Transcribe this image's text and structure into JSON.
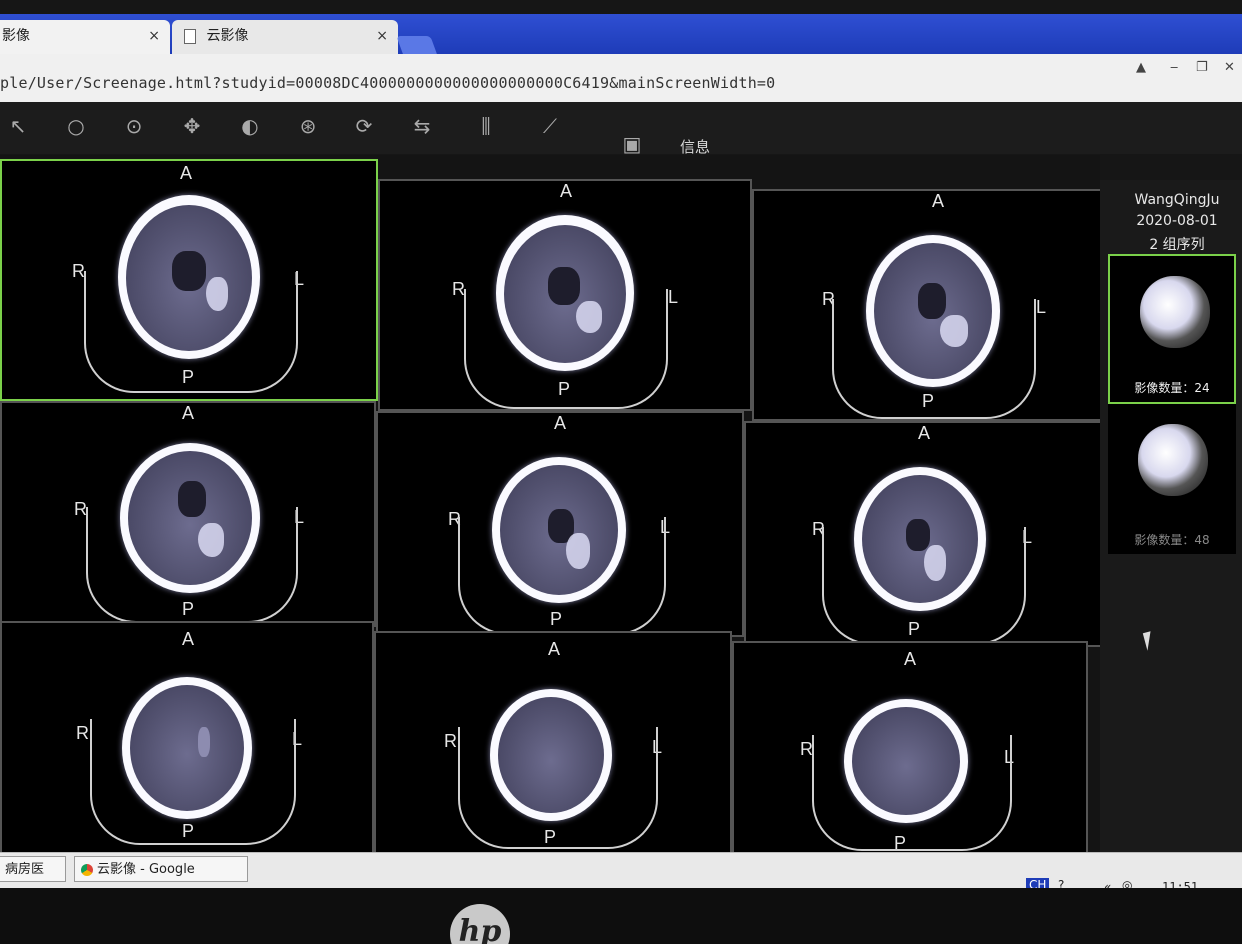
{
  "browser": {
    "tabs": [
      {
        "label": "影像",
        "close": "×"
      },
      {
        "label": "云影像",
        "close": "×"
      }
    ],
    "url": "ple/User/Screenage.html?studyid=00008DC4000000000000000000000C6419&mainScreenWidth=0"
  },
  "toolbar": {
    "info_label": "信息"
  },
  "viewer": {
    "orientation": {
      "anterior": "A",
      "posterior": "P",
      "right": "R",
      "left": "L"
    }
  },
  "patient": {
    "name": "WangQingJu",
    "date": "2020-08-01",
    "series_count": "2 组序列"
  },
  "series": [
    {
      "count_label": "影像数量：24",
      "selected": true
    },
    {
      "count_label": "影像数量：48",
      "selected": false
    }
  ],
  "taskbar": {
    "items": [
      "病房医",
      "云影像 - Google Chrome"
    ],
    "ime": "CH",
    "clock": "11:51"
  },
  "colors": {
    "accent": "#7bd14a",
    "tabbar": "#2f4fd3",
    "viewport_bg": "#000000"
  }
}
